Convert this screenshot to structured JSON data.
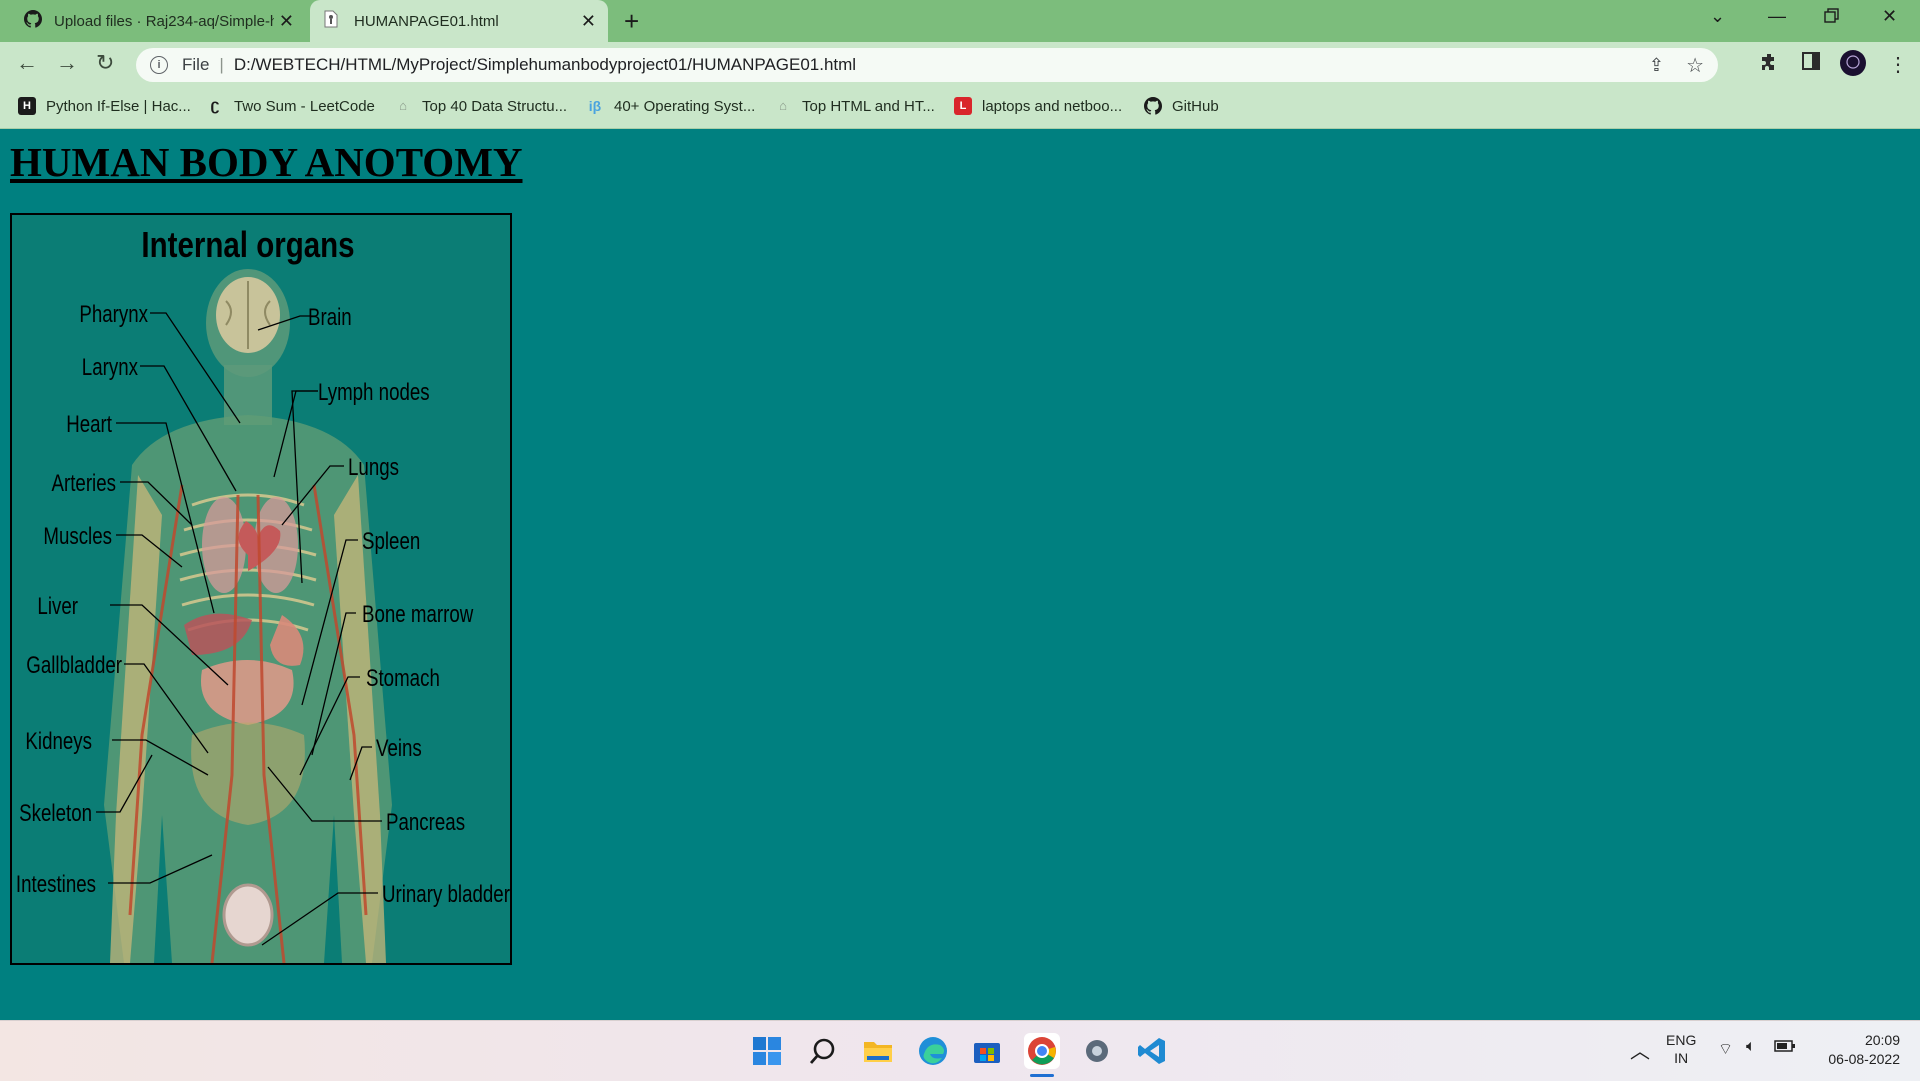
{
  "browser": {
    "tabs": [
      {
        "label": "Upload files · Raj234-aq/Simple-h",
        "icon": "github-icon",
        "active": false
      },
      {
        "label": "HUMANPAGE01.html",
        "icon": "file-icon",
        "active": true
      }
    ],
    "new_tab": "+",
    "address": {
      "scheme_label": "File",
      "url": "D:/WEBTECH/HTML/MyProject/Simplehumanbodyproject01/HUMANPAGE01.html"
    },
    "bookmarks": [
      {
        "label": "Python If-Else | Hac...",
        "icon": "hackerrank-icon"
      },
      {
        "label": "Two Sum - LeetCode",
        "icon": "leetcode-icon"
      },
      {
        "label": "Top 40 Data Structu...",
        "icon": "site-icon"
      },
      {
        "label": "40+ Operating Syst...",
        "icon": "interviewbit-icon"
      },
      {
        "label": "Top HTML and HT...",
        "icon": "site-icon"
      },
      {
        "label": "laptops and netboo...",
        "icon": "l-icon"
      },
      {
        "label": "GitHub",
        "icon": "github-icon"
      }
    ]
  },
  "page": {
    "heading": "HUMAN BODY ANOTOMY",
    "figure": {
      "title": "Internal organs",
      "left_labels": [
        "Pharynx",
        "Larynx",
        "Heart",
        "Arteries",
        "Muscles",
        "Liver",
        "Gallbladder",
        "Kidneys",
        "Skeleton",
        "Intestines"
      ],
      "right_labels": [
        "Brain",
        "Lymph nodes",
        "Lungs",
        "Spleen",
        "Bone marrow",
        "Stomach",
        "Veins",
        "Pancreas",
        "Urinary bladder"
      ]
    },
    "background_color": "#008080"
  },
  "taskbar": {
    "apps": [
      "windows-start-icon",
      "search-icon",
      "file-explorer-icon",
      "edge-icon",
      "store-icon",
      "chrome-icon",
      "settings-icon",
      "vscode-icon"
    ],
    "language": "ENG",
    "region": "IN",
    "time": "20:09",
    "date": "06-08-2022"
  }
}
